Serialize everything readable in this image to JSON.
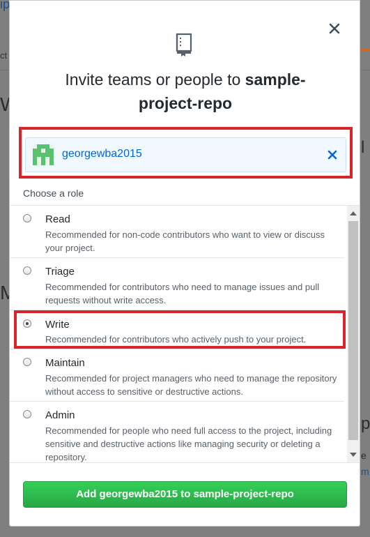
{
  "background": {
    "fragments": [
      "ip",
      "ct",
      "W",
      "M",
      "p",
      "e",
      "m",
      "l"
    ]
  },
  "dialog": {
    "title_prefix": "Invite teams or people to ",
    "repo_name": "sample-project-repo",
    "close_icon": "close-icon",
    "repo_icon": "repo-icon"
  },
  "selected_user": {
    "username": "georgewba2015",
    "avatar_icon": "identicon-avatar",
    "remove_icon": "remove-icon"
  },
  "roles_heading": "Choose a role",
  "roles": [
    {
      "name": "Read",
      "description": "Recommended for non-code contributors who want to view or discuss your project.",
      "checked": false
    },
    {
      "name": "Triage",
      "description": "Recommended for contributors who need to manage issues and pull requests without write access.",
      "checked": false
    },
    {
      "name": "Write",
      "description": "Recommended for contributors who actively push to your project.",
      "checked": true
    },
    {
      "name": "Maintain",
      "description": "Recommended for project managers who need to manage the repository without access to sensitive or destructive actions.",
      "checked": false
    },
    {
      "name": "Admin",
      "description": "Recommended for people who need full access to the project, including sensitive and destructive actions like managing security or deleting a repository.",
      "checked": false
    }
  ],
  "action_button": {
    "label": "Add georgewba2015 to sample-project-repo"
  },
  "colors": {
    "highlight": "#d7262b",
    "primary_button": "#28a745",
    "link": "#0366d6"
  }
}
